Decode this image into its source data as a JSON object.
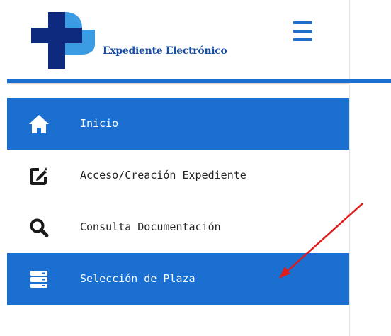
{
  "brand": {
    "name": "Expediente Electrónico",
    "accent_color": "#1a6fd1",
    "logo_dark_color": "#0d2a7e",
    "logo_light_color": "#3b9be3"
  },
  "header": {
    "menu_icon": "hamburger-icon"
  },
  "menu": {
    "items": [
      {
        "label": "Inicio",
        "icon": "home-icon",
        "active": true
      },
      {
        "label": "Acceso/Creación Expediente",
        "icon": "edit-square-icon",
        "active": false
      },
      {
        "label": "Consulta Documentación",
        "icon": "search-icon",
        "active": false
      },
      {
        "label": "Selección de Plaza",
        "icon": "server-icon",
        "active": true
      }
    ]
  },
  "annotation": {
    "arrow_color": "#e01b1b",
    "target": "Selección de Plaza"
  }
}
